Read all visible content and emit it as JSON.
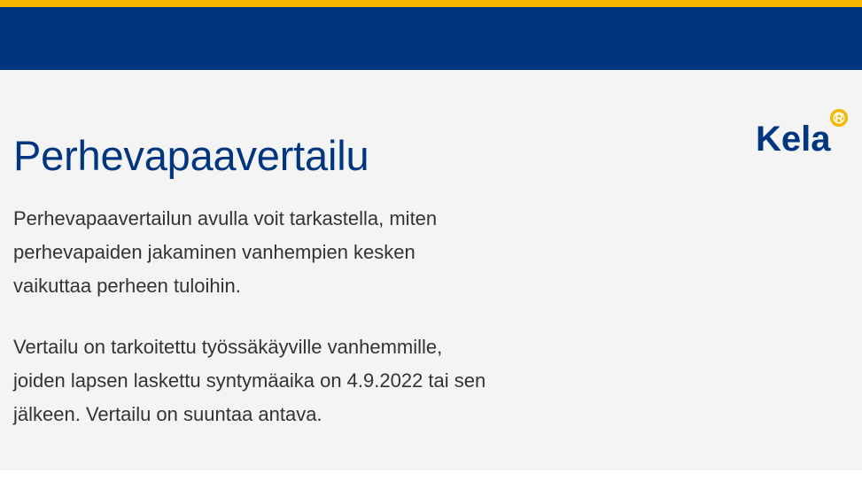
{
  "colors": {
    "accent_stripe": "#f7b600",
    "header": "#003580",
    "hero_background": "#f4f4f4",
    "title": "#003580",
    "body_text": "#333333"
  },
  "logo": {
    "text": "Kela",
    "mark_text": "R",
    "icon": "registered-mark-icon"
  },
  "main": {
    "title": "Perhevapaavertailu",
    "paragraphs": [
      "Perhevapaavertailun avulla voit tarkastella, miten perhevapaiden jakaminen vanhempien kesken vaikuttaa perheen tuloihin.",
      "Vertailu on tarkoitettu työssäkäyville vanhemmille, joiden lapsen laskettu syntymäaika on 4.9.2022 tai sen jälkeen. Vertailu on suuntaa antava."
    ]
  }
}
